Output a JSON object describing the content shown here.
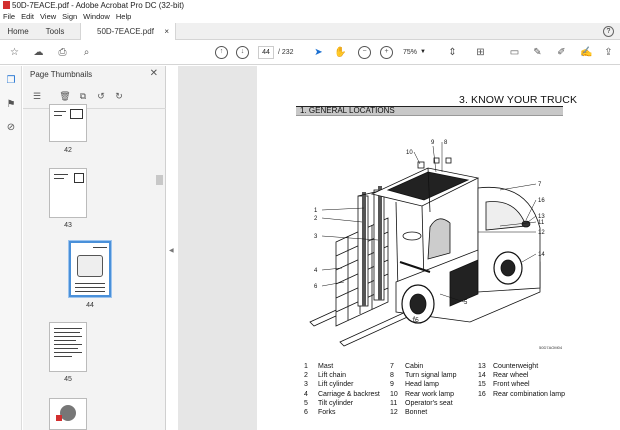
{
  "window": {
    "title": "50D-7EACE.pdf - Adobe Acrobat Pro DC (32-bit)"
  },
  "menu": [
    "File",
    "Edit",
    "View",
    "Sign",
    "Window",
    "Help"
  ],
  "tabs": {
    "home": "Home",
    "tools": "Tools",
    "document": "50D-7EACE.pdf",
    "close": "×"
  },
  "toolbar": {
    "current_page": "44",
    "page_count": "/ 232",
    "zoom": "75%"
  },
  "panel": {
    "title": "Page Thumbnails",
    "thumbnails": [
      {
        "label": "42"
      },
      {
        "label": "43"
      },
      {
        "label": "44",
        "selected": true
      },
      {
        "label": "45"
      }
    ]
  },
  "document": {
    "chapter_title": "3. KNOW YOUR TRUCK",
    "section_title": "1. GENERAL LOCATIONS",
    "figure_code": "50D7AOM04",
    "callouts": [
      "1",
      "2",
      "3",
      "4",
      "5",
      "6",
      "7",
      "8",
      "9",
      "10",
      "11",
      "12",
      "13",
      "14",
      "15",
      "16"
    ],
    "legend": [
      {
        "num": "1",
        "label": "Mast"
      },
      {
        "num": "2",
        "label": "Lift chain"
      },
      {
        "num": "3",
        "label": "Lift cylinder"
      },
      {
        "num": "4",
        "label": "Carriage & backrest"
      },
      {
        "num": "5",
        "label": "Tilt cylinder"
      },
      {
        "num": "6",
        "label": "Forks"
      },
      {
        "num": "7",
        "label": "Cabin"
      },
      {
        "num": "8",
        "label": "Turn signal lamp"
      },
      {
        "num": "9",
        "label": "Head lamp"
      },
      {
        "num": "10",
        "label": "Rear work lamp"
      },
      {
        "num": "11",
        "label": "Operator's seat"
      },
      {
        "num": "12",
        "label": "Bonnet"
      },
      {
        "num": "13",
        "label": "Counterweight"
      },
      {
        "num": "14",
        "label": "Rear wheel"
      },
      {
        "num": "15",
        "label": "Front wheel"
      },
      {
        "num": "16",
        "label": "Rear combination lamp"
      }
    ]
  },
  "colors": {
    "accent": "#1a6fd1",
    "selection": "#4a90d9",
    "pdf_red": "#d32f2f"
  }
}
